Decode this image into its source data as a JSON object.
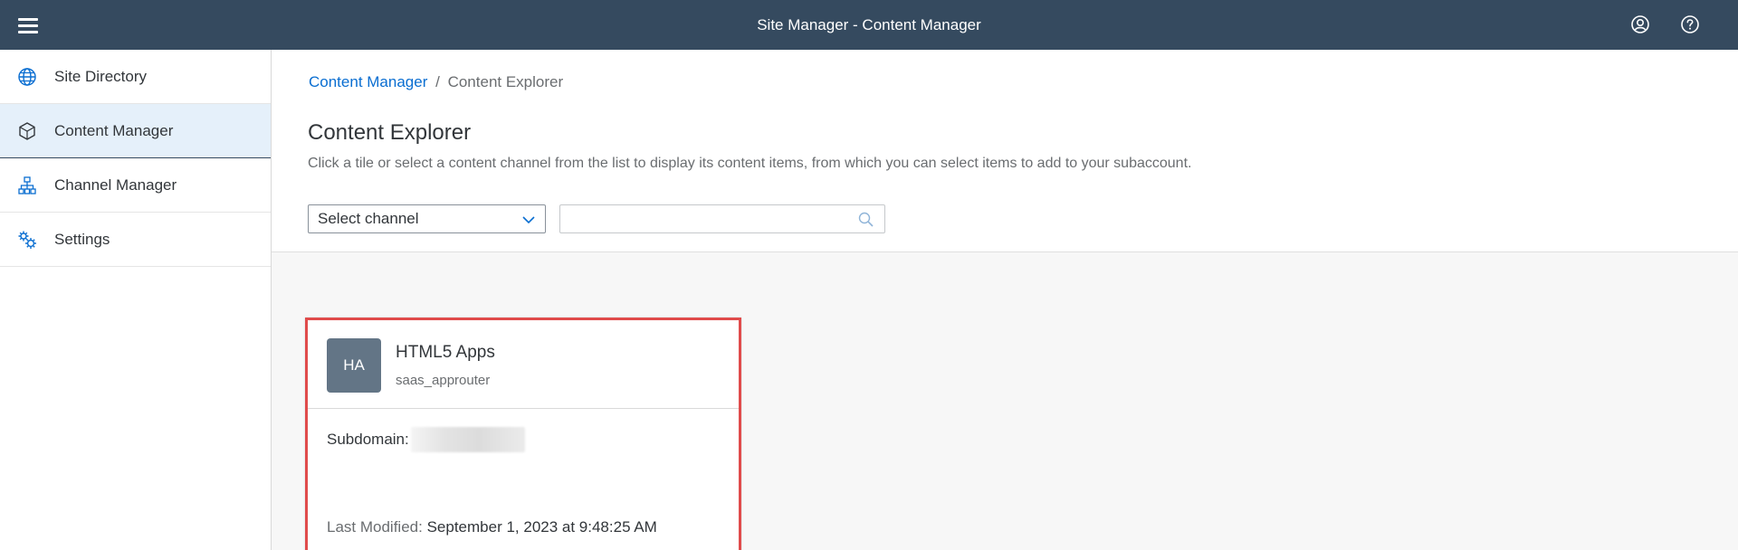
{
  "shell": {
    "title": "Site Manager - Content Manager",
    "menu_icon": "hamburger-menu-icon",
    "user_icon": "user-account-icon",
    "help_icon": "help-icon"
  },
  "sidebar": {
    "items": [
      {
        "label": "Site Directory",
        "icon": "globe-icon",
        "active": false
      },
      {
        "label": "Content Manager",
        "icon": "cube-icon",
        "active": true
      },
      {
        "label": "Channel Manager",
        "icon": "hierarchy-icon",
        "active": false
      },
      {
        "label": "Settings",
        "icon": "settings-icon",
        "active": false
      }
    ]
  },
  "main": {
    "breadcrumb": {
      "link": "Content Manager",
      "separator": "/",
      "current": "Content Explorer"
    },
    "title": "Content Explorer",
    "description": "Click a tile or select a content channel from the list to display its content items, from which you can select items to add to your subaccount.",
    "channel_select": {
      "value": "Select channel",
      "icon": "chevron-down-icon"
    },
    "search": {
      "value": "",
      "placeholder": "",
      "icon": "search-icon"
    }
  },
  "card": {
    "initials": "HA",
    "title": "HTML5 Apps",
    "subtitle": "saas_approuter",
    "subdomain_label": "Subdomain:",
    "last_modified_label": "Last Modified:",
    "last_modified_value": "September 1, 2023 at 9:48:25 AM"
  },
  "colors": {
    "shellbar": "#354a5f",
    "link": "#0a6ed1",
    "active_nav": "#e5f0fa",
    "avatar": "#637586",
    "highlight_border": "#e04b4b",
    "content_bg": "#f7f7f7"
  }
}
